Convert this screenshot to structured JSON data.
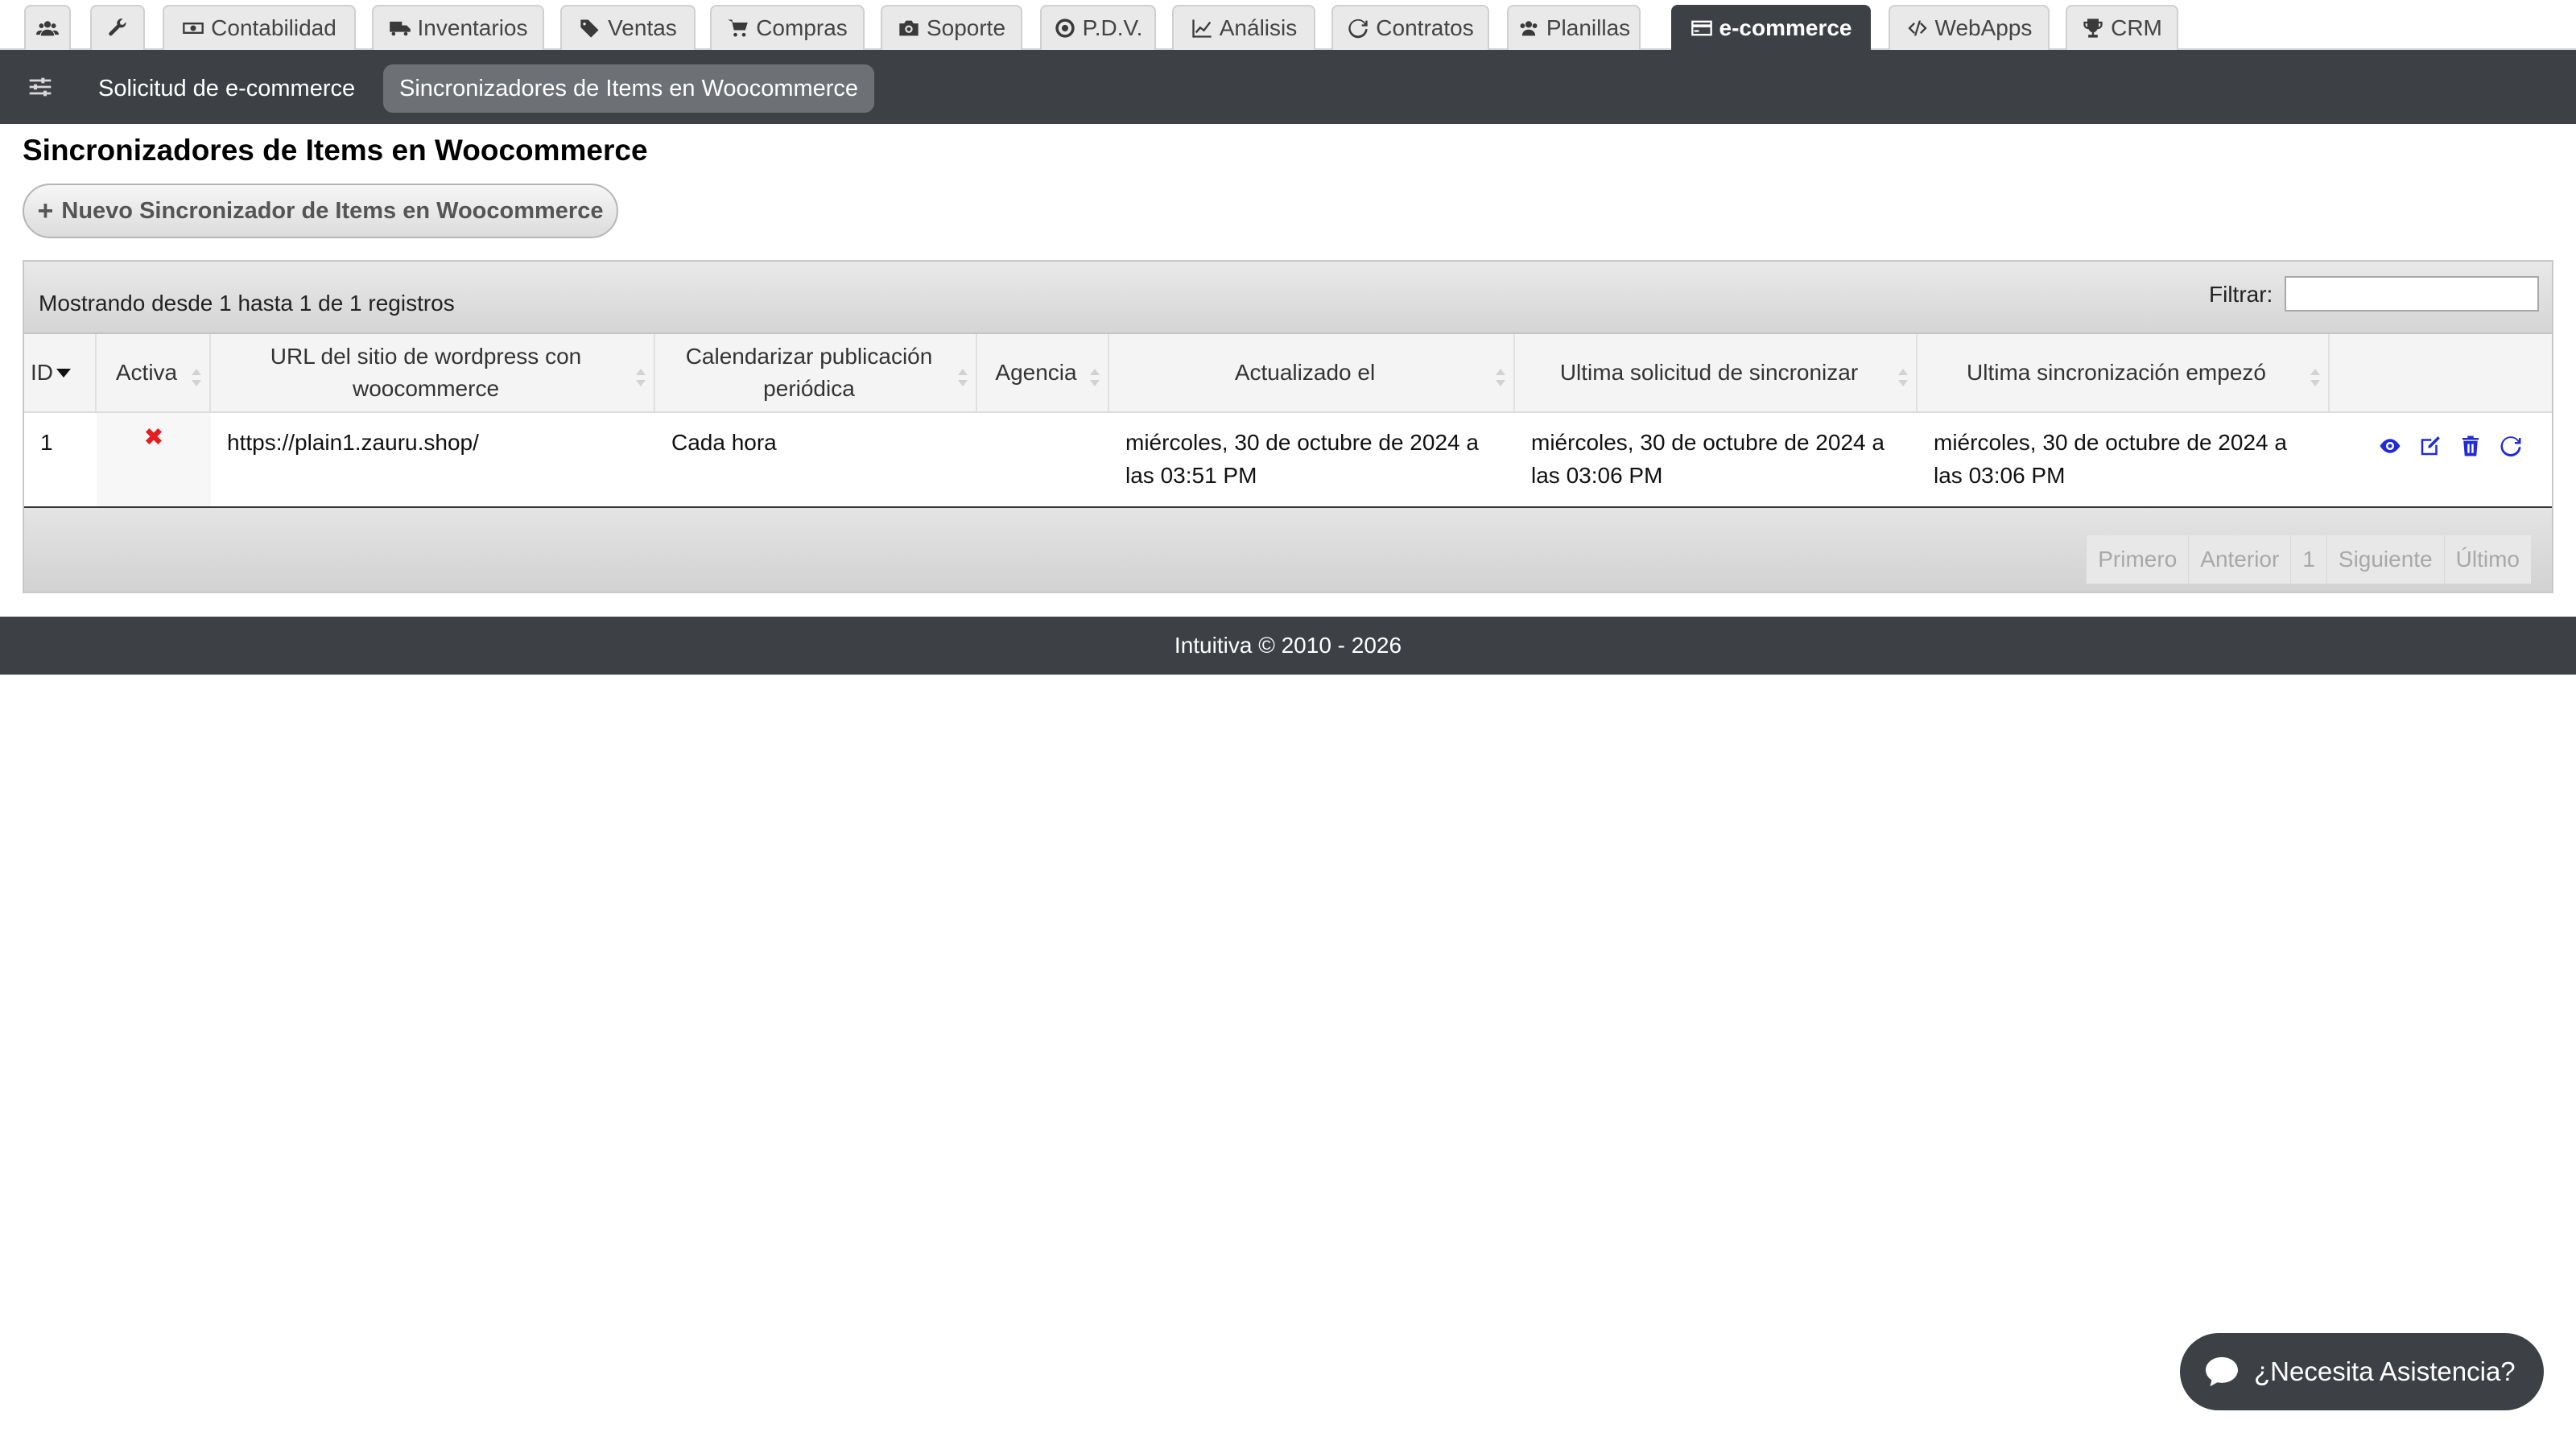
{
  "top_tabs": [
    {
      "label": "",
      "icon": "users-icon"
    },
    {
      "label": "",
      "icon": "wrench-icon"
    },
    {
      "label": "Contabilidad",
      "icon": "money-icon"
    },
    {
      "label": "Inventarios",
      "icon": "truck-icon"
    },
    {
      "label": "Ventas",
      "icon": "tags-icon"
    },
    {
      "label": "Compras",
      "icon": "cart-icon"
    },
    {
      "label": "Soporte",
      "icon": "camera-icon"
    },
    {
      "label": "P.D.V.",
      "icon": "target-icon"
    },
    {
      "label": "Análisis",
      "icon": "line-chart-icon"
    },
    {
      "label": "Contratos",
      "icon": "refresh-icon"
    },
    {
      "label": "Planillas",
      "icon": "group-icon"
    },
    {
      "label": "e-commerce",
      "icon": "credit-card-icon",
      "active": true
    },
    {
      "label": "WebApps",
      "icon": "code-icon"
    },
    {
      "label": "CRM",
      "icon": "trophy-icon"
    }
  ],
  "subnav": {
    "items": [
      {
        "label": "Solicitud de e-commerce"
      },
      {
        "label": "Sincronizadores de Items en Woocommerce",
        "active": true
      }
    ]
  },
  "page": {
    "title": "Sincronizadores de Items en Woocommerce",
    "new_button": "Nuevo Sincronizador de Items en Woocommerce"
  },
  "table": {
    "info": "Mostrando desde 1 hasta 1 de 1 registros",
    "filter_label": "Filtrar:",
    "filter_value": "",
    "columns": [
      "ID",
      "Activa",
      "URL del sitio de wordpress con woocommerce",
      "Calendarizar publicación periódica",
      "Agencia",
      "Actualizado el",
      "Ultima solicitud de sincronizar",
      "Ultima sincronización empezó",
      ""
    ],
    "rows": [
      {
        "id": "1",
        "activa_icon": "✖",
        "url": "https://plain1.zauru.shop/",
        "calendarizar": "Cada hora",
        "agencia": "",
        "actualizado": "miércoles, 30 de octubre de 2024 a las 03:51 PM",
        "ultima_solicitud": "miércoles, 30 de octubre de 2024 a las 03:06 PM",
        "ultima_sincronizacion": "miércoles, 30 de octubre de 2024 a las 03:06 PM"
      }
    ],
    "pagination": [
      "Primero",
      "Anterior",
      "1",
      "Siguiente",
      "Último"
    ]
  },
  "footer": {
    "text": "Intuitiva © 2010 - 2026"
  },
  "help": {
    "label": "¿Necesita Asistencia?"
  },
  "colors": {
    "dark_bar": "#3d4145",
    "action_blue": "#1f2bd8",
    "inactive_red": "#e41e1e"
  }
}
